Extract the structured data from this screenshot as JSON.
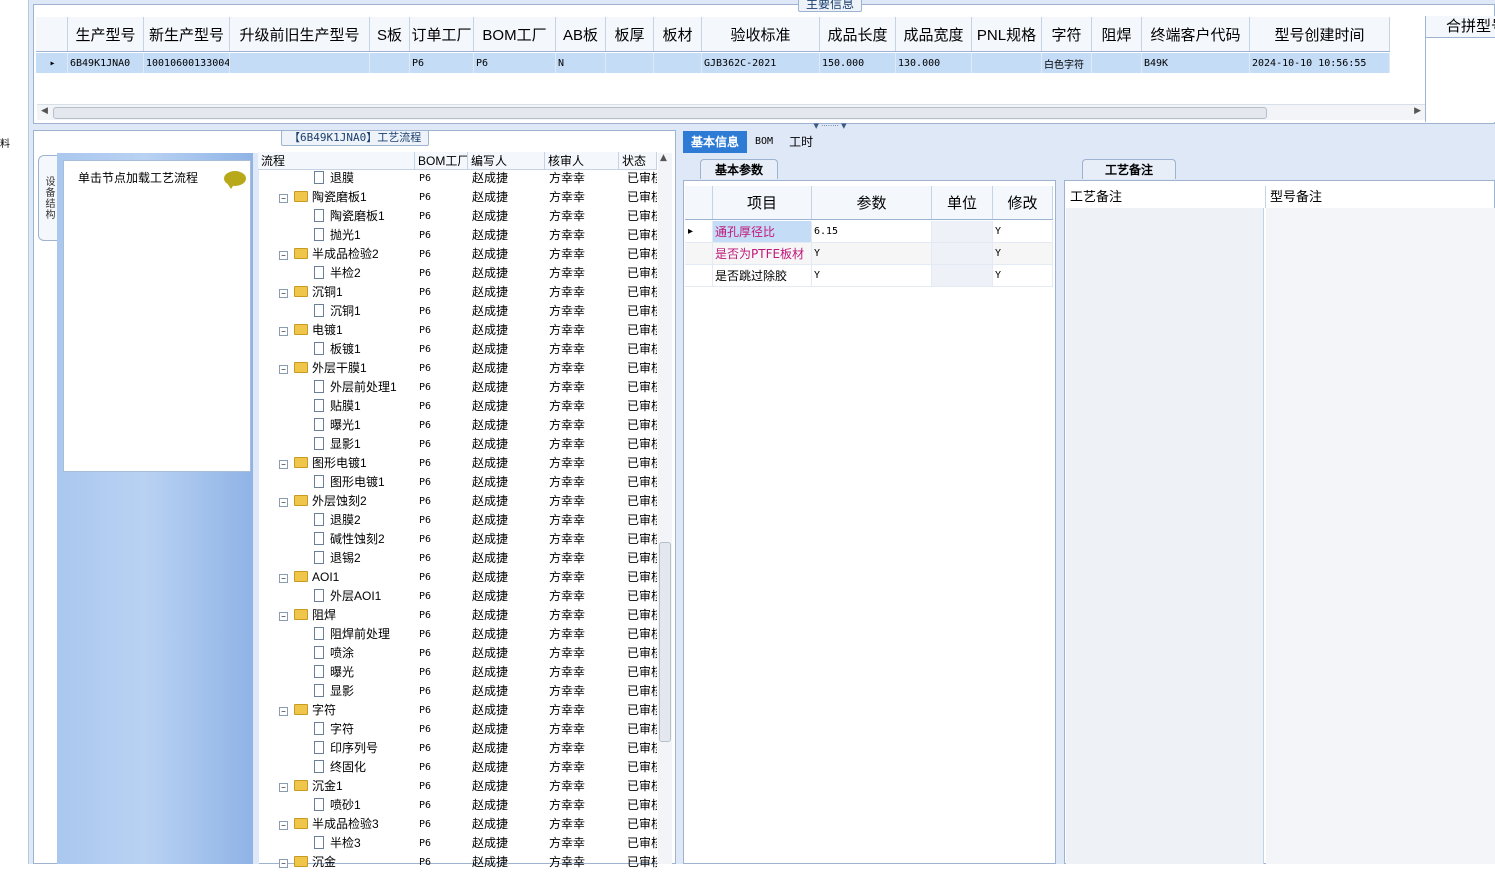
{
  "leftbar_char": "料",
  "main_group": {
    "title": "主要信息",
    "columns": [
      "生产型号",
      "新生产型号",
      "升级前旧生产型号",
      "S板",
      "订单工厂",
      "BOM工厂",
      "AB板",
      "板厚",
      "板材",
      "验收标准",
      "成品长度",
      "成品宽度",
      "PNL规格",
      "字符",
      "阻焊",
      "终端客户代码",
      "型号创建时间"
    ],
    "row": [
      "6B49K1JNA0",
      "10010600133004",
      "",
      "",
      "P6",
      "P6",
      "N",
      "",
      "",
      "GJB362C-2021",
      "150.000",
      "130.000",
      "",
      "白色字符",
      "",
      "B49K",
      "2024-10-10 10:56:55"
    ],
    "merge_header": "合拼型号"
  },
  "flow_panel": {
    "title": "【6B49K1JNA0】工艺流程",
    "side_tab": "设备结构",
    "hint": "单击节点加载工艺流程",
    "columns": [
      "流程",
      "BOM工厂",
      "编写人",
      "核审人",
      "状态"
    ],
    "rows": [
      {
        "level": 2,
        "name": "退膜",
        "bom": "P6",
        "writer": "赵成捷",
        "reviewer": "方幸幸",
        "status": "已审核"
      },
      {
        "level": 1,
        "name": "陶瓷磨板1",
        "bom": "P6",
        "writer": "赵成捷",
        "reviewer": "方幸幸",
        "status": "已审核"
      },
      {
        "level": 2,
        "name": "陶瓷磨板1",
        "bom": "P6",
        "writer": "赵成捷",
        "reviewer": "方幸幸",
        "status": "已审核"
      },
      {
        "level": 2,
        "name": "抛光1",
        "bom": "P6",
        "writer": "赵成捷",
        "reviewer": "方幸幸",
        "status": "已审核"
      },
      {
        "level": 1,
        "name": "半成品检验2",
        "bom": "P6",
        "writer": "赵成捷",
        "reviewer": "方幸幸",
        "status": "已审核"
      },
      {
        "level": 2,
        "name": "半检2",
        "bom": "P6",
        "writer": "赵成捷",
        "reviewer": "方幸幸",
        "status": "已审核"
      },
      {
        "level": 1,
        "name": "沉铜1",
        "bom": "P6",
        "writer": "赵成捷",
        "reviewer": "方幸幸",
        "status": "已审核"
      },
      {
        "level": 2,
        "name": "沉铜1",
        "bom": "P6",
        "writer": "赵成捷",
        "reviewer": "方幸幸",
        "status": "已审核"
      },
      {
        "level": 1,
        "name": "电镀1",
        "bom": "P6",
        "writer": "赵成捷",
        "reviewer": "方幸幸",
        "status": "已审核"
      },
      {
        "level": 2,
        "name": "板镀1",
        "bom": "P6",
        "writer": "赵成捷",
        "reviewer": "方幸幸",
        "status": "已审核"
      },
      {
        "level": 1,
        "name": "外层干膜1",
        "bom": "P6",
        "writer": "赵成捷",
        "reviewer": "方幸幸",
        "status": "已审核"
      },
      {
        "level": 2,
        "name": "外层前处理1",
        "bom": "P6",
        "writer": "赵成捷",
        "reviewer": "方幸幸",
        "status": "已审核"
      },
      {
        "level": 2,
        "name": "贴膜1",
        "bom": "P6",
        "writer": "赵成捷",
        "reviewer": "方幸幸",
        "status": "已审核"
      },
      {
        "level": 2,
        "name": "曝光1",
        "bom": "P6",
        "writer": "赵成捷",
        "reviewer": "方幸幸",
        "status": "已审核"
      },
      {
        "level": 2,
        "name": "显影1",
        "bom": "P6",
        "writer": "赵成捷",
        "reviewer": "方幸幸",
        "status": "已审核"
      },
      {
        "level": 1,
        "name": "图形电镀1",
        "bom": "P6",
        "writer": "赵成捷",
        "reviewer": "方幸幸",
        "status": "已审核"
      },
      {
        "level": 2,
        "name": "图形电镀1",
        "bom": "P6",
        "writer": "赵成捷",
        "reviewer": "方幸幸",
        "status": "已审核"
      },
      {
        "level": 1,
        "name": "外层蚀刻2",
        "bom": "P6",
        "writer": "赵成捷",
        "reviewer": "方幸幸",
        "status": "已审核"
      },
      {
        "level": 2,
        "name": "退膜2",
        "bom": "P6",
        "writer": "赵成捷",
        "reviewer": "方幸幸",
        "status": "已审核"
      },
      {
        "level": 2,
        "name": "碱性蚀刻2",
        "bom": "P6",
        "writer": "赵成捷",
        "reviewer": "方幸幸",
        "status": "已审核"
      },
      {
        "level": 2,
        "name": "退锡2",
        "bom": "P6",
        "writer": "赵成捷",
        "reviewer": "方幸幸",
        "status": "已审核"
      },
      {
        "level": 1,
        "name": "AOI1",
        "bom": "P6",
        "writer": "赵成捷",
        "reviewer": "方幸幸",
        "status": "已审核"
      },
      {
        "level": 2,
        "name": "外层AOI1",
        "bom": "P6",
        "writer": "赵成捷",
        "reviewer": "方幸幸",
        "status": "已审核"
      },
      {
        "level": 1,
        "name": "阻焊",
        "bom": "P6",
        "writer": "赵成捷",
        "reviewer": "方幸幸",
        "status": "已审核"
      },
      {
        "level": 2,
        "name": "阻焊前处理",
        "bom": "P6",
        "writer": "赵成捷",
        "reviewer": "方幸幸",
        "status": "已审核"
      },
      {
        "level": 2,
        "name": "喷涂",
        "bom": "P6",
        "writer": "赵成捷",
        "reviewer": "方幸幸",
        "status": "已审核"
      },
      {
        "level": 2,
        "name": "曝光",
        "bom": "P6",
        "writer": "赵成捷",
        "reviewer": "方幸幸",
        "status": "已审核"
      },
      {
        "level": 2,
        "name": "显影",
        "bom": "P6",
        "writer": "赵成捷",
        "reviewer": "方幸幸",
        "status": "已审核"
      },
      {
        "level": 1,
        "name": "字符",
        "bom": "P6",
        "writer": "赵成捷",
        "reviewer": "方幸幸",
        "status": "已审核"
      },
      {
        "level": 2,
        "name": "字符",
        "bom": "P6",
        "writer": "赵成捷",
        "reviewer": "方幸幸",
        "status": "已审核"
      },
      {
        "level": 2,
        "name": "印序列号",
        "bom": "P6",
        "writer": "赵成捷",
        "reviewer": "方幸幸",
        "status": "已审核"
      },
      {
        "level": 2,
        "name": "终固化",
        "bom": "P6",
        "writer": "赵成捷",
        "reviewer": "方幸幸",
        "status": "已审核"
      },
      {
        "level": 1,
        "name": "沉金1",
        "bom": "P6",
        "writer": "赵成捷",
        "reviewer": "方幸幸",
        "status": "已审核"
      },
      {
        "level": 2,
        "name": "喷砂1",
        "bom": "P6",
        "writer": "赵成捷",
        "reviewer": "方幸幸",
        "status": "已审核"
      },
      {
        "level": 1,
        "name": "半成品检验3",
        "bom": "P6",
        "writer": "赵成捷",
        "reviewer": "方幸幸",
        "status": "已审核"
      },
      {
        "level": 2,
        "name": "半检3",
        "bom": "P6",
        "writer": "赵成捷",
        "reviewer": "方幸幸",
        "status": "已审核"
      },
      {
        "level": 1,
        "name": "沉金",
        "bom": "P6",
        "writer": "赵成捷",
        "reviewer": "方幸幸",
        "status": "已审核"
      }
    ]
  },
  "right_tabs": [
    "基本信息",
    "BOM",
    "工时"
  ],
  "basic_params": {
    "tab": "基本参数",
    "columns": [
      "项目",
      "参数",
      "单位",
      "修改"
    ],
    "rows": [
      {
        "item": "通孔厚径比",
        "value": "6.15",
        "unit": "",
        "modify": "Y",
        "color": "#c0177a"
      },
      {
        "item": "是否为PTFE板材",
        "value": "Y",
        "unit": "",
        "modify": "Y",
        "color": "#c0177a"
      },
      {
        "item": "是否跳过除胶",
        "value": "Y",
        "unit": "",
        "modify": "Y",
        "color": "#000000"
      }
    ]
  },
  "process_notes": {
    "tab": "工艺备注",
    "columns": [
      "工艺备注",
      "型号备注"
    ]
  },
  "colors": {
    "accent": "#2e7bd6",
    "selection": "#c4dcf6",
    "border": "#9db3d0"
  }
}
